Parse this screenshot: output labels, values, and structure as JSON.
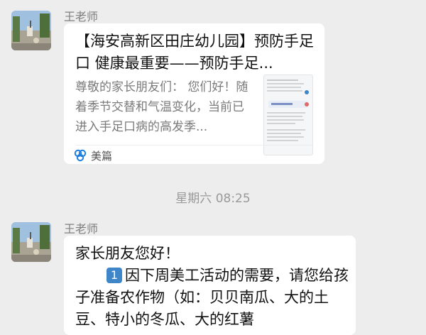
{
  "messages": {
    "first": {
      "sender": "王老师",
      "card": {
        "title": "【海安高新区田庄幼儿园】预防手足口 健康最重要——预防手足...",
        "description": "尊敬的家长朋友们： 您们好！随着季节交替和气温变化，当前已进入手足口病的高发季...",
        "source": "美篇",
        "source_icon": "meipian-logo-icon"
      }
    },
    "timestamp": "星期六 08:25",
    "second": {
      "sender": "王老师",
      "greeting": "家长朋友您好！",
      "item_number": "1",
      "body": "因下周美工活动的需要，请您给孩子准备农作物（如：贝贝南瓜、大的土豆、特小的冬瓜、大的红薯"
    }
  },
  "colors": {
    "background": "#ededed",
    "bubble": "#ffffff",
    "accent": "#3f86c9"
  }
}
